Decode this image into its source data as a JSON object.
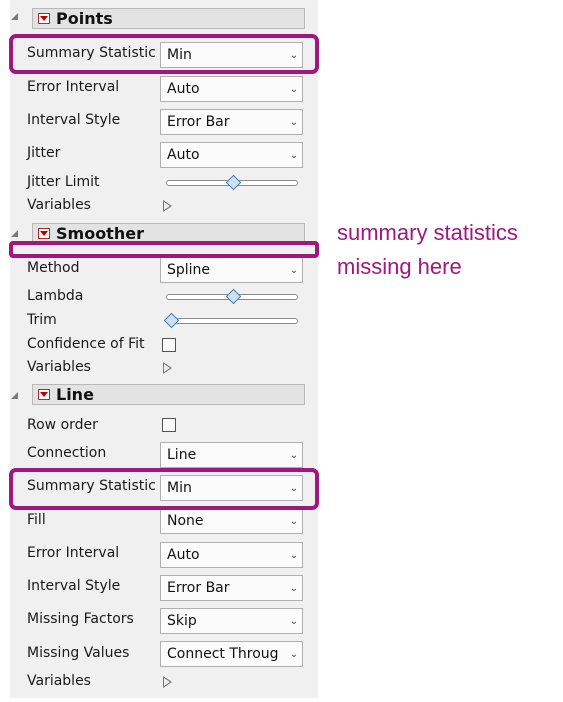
{
  "points": {
    "title": "Points",
    "summary_statistic": {
      "label": "Summary Statistic",
      "value": "Min"
    },
    "error_interval": {
      "label": "Error Interval",
      "value": "Auto"
    },
    "interval_style": {
      "label": "Interval Style",
      "value": "Error Bar"
    },
    "jitter": {
      "label": "Jitter",
      "value": "Auto"
    },
    "jitter_limit": {
      "label": "Jitter Limit"
    },
    "variables": {
      "label": "Variables"
    }
  },
  "smoother": {
    "title": "Smoother",
    "method": {
      "label": "Method",
      "value": "Spline"
    },
    "lambda": {
      "label": "Lambda"
    },
    "trim": {
      "label": "Trim"
    },
    "confidence_of_fit": {
      "label": "Confidence of Fit"
    },
    "variables": {
      "label": "Variables"
    }
  },
  "line": {
    "title": "Line",
    "row_order": {
      "label": "Row order"
    },
    "connection": {
      "label": "Connection",
      "value": "Line"
    },
    "summary_statistic": {
      "label": "Summary Statistic",
      "value": "Min"
    },
    "fill": {
      "label": "Fill",
      "value": "None"
    },
    "error_interval": {
      "label": "Error Interval",
      "value": "Auto"
    },
    "interval_style": {
      "label": "Interval Style",
      "value": "Error Bar"
    },
    "missing_factors": {
      "label": "Missing Factors",
      "value": "Skip"
    },
    "missing_values": {
      "label": "Missing Values",
      "value": "Connect Throug"
    },
    "variables": {
      "label": "Variables"
    }
  },
  "annotation": {
    "line1": "summary statistics",
    "line2": "missing here"
  },
  "colors": {
    "highlight": "#a0177f",
    "menu_button": "#c00000"
  },
  "icons": {
    "dropdown": "chevron-down-icon",
    "expander": "triangle-right-icon",
    "section_toggle": "collapse-triangle-icon",
    "section_menu": "red-menu-icon"
  }
}
